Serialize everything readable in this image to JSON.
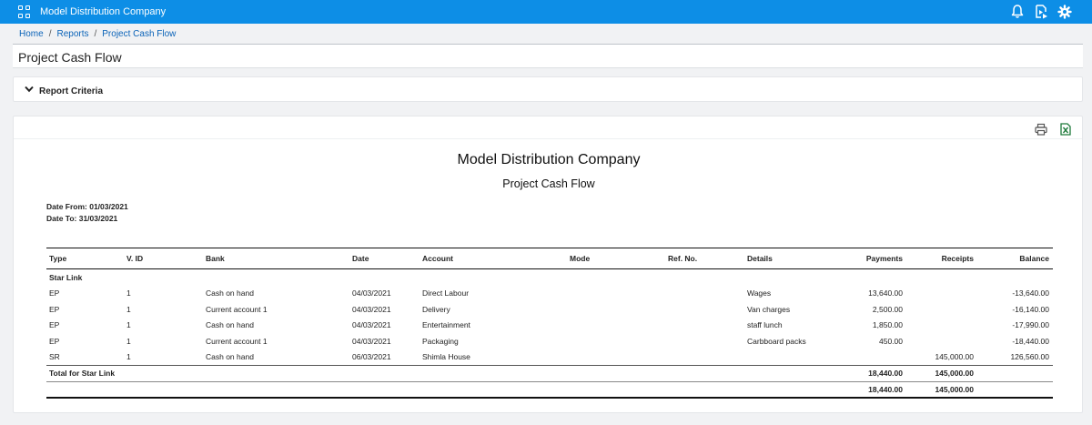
{
  "app": {
    "title": "Model Distribution Company"
  },
  "breadcrumb": [
    "Home",
    "Reports",
    "Project Cash Flow"
  ],
  "page": {
    "title": "Project Cash Flow"
  },
  "criteria": {
    "label": "Report Criteria"
  },
  "report": {
    "company": "Model Distribution Company",
    "title": "Project Cash Flow",
    "date_from": "Date From: 01/03/2021",
    "date_to": "Date To: 31/03/2021",
    "columns": [
      "Type",
      "V. ID",
      "Bank",
      "Date",
      "Account",
      "Mode",
      "Ref. No.",
      "Details",
      "Payments",
      "Receipts",
      "Balance"
    ],
    "group": "Star Link",
    "rows": [
      [
        "EP",
        "1",
        "Cash on hand",
        "04/03/2021",
        "Direct Labour",
        "",
        "",
        "Wages",
        "13,640.00",
        "",
        "-13,640.00"
      ],
      [
        "EP",
        "1",
        "Current account 1",
        "04/03/2021",
        "Delivery",
        "",
        "",
        "Van charges",
        "2,500.00",
        "",
        "-16,140.00"
      ],
      [
        "EP",
        "1",
        "Cash on hand",
        "04/03/2021",
        "Entertainment",
        "",
        "",
        "staff lunch",
        "1,850.00",
        "",
        "-17,990.00"
      ],
      [
        "EP",
        "1",
        "Current account 1",
        "04/03/2021",
        "Packaging",
        "",
        "",
        "Carbboard packs",
        "450.00",
        "",
        "-18,440.00"
      ],
      [
        "SR",
        "1",
        "Cash on hand",
        "06/03/2021",
        "Shimla House",
        "",
        "",
        "",
        "",
        "145,000.00",
        "126,560.00"
      ]
    ],
    "group_total": {
      "label": "Total for Star Link",
      "payments": "18,440.00",
      "receipts": "145,000.00"
    },
    "grand_total": {
      "payments": "18,440.00",
      "receipts": "145,000.00"
    }
  },
  "icons": [
    "apps-grid-icon",
    "bell-icon",
    "play-document-icon",
    "gear-icon",
    "chevron-down-icon",
    "print-icon",
    "excel-icon"
  ],
  "colors": {
    "topbar": "#0d8ee6",
    "link": "#0a63b8",
    "excel": "#1d7a3a"
  }
}
